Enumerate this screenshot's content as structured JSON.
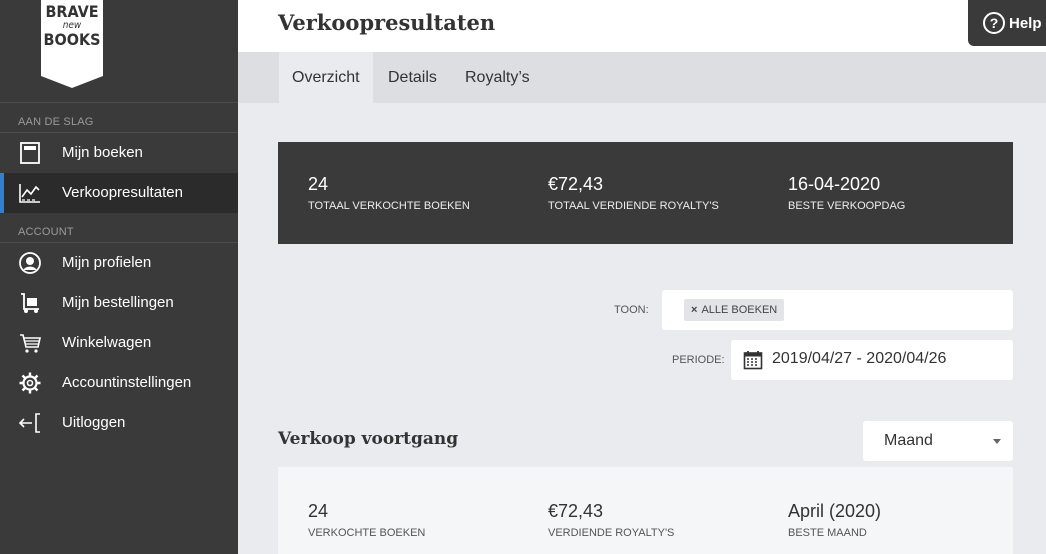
{
  "brand": {
    "line1": "BRAVE",
    "line2": "new",
    "line3": "BOOKS"
  },
  "sidebar": {
    "section1": "AAN DE SLAG",
    "section2": "ACCOUNT",
    "items": [
      {
        "label": "Mijn boeken",
        "icon": "book-icon"
      },
      {
        "label": "Verkoopresultaten",
        "icon": "chart-icon",
        "active": true
      },
      {
        "label": "Mijn profielen",
        "icon": "profile-icon"
      },
      {
        "label": "Mijn bestellingen",
        "icon": "order-icon"
      },
      {
        "label": "Winkelwagen",
        "icon": "cart-icon"
      },
      {
        "label": "Accountinstellingen",
        "icon": "gear-icon"
      },
      {
        "label": "Uitloggen",
        "icon": "logout-icon"
      }
    ]
  },
  "header": {
    "title": "Verkoopresultaten",
    "help_label": "Help",
    "help_symbol": "?"
  },
  "tabs": [
    {
      "label": "Overzicht",
      "active": true
    },
    {
      "label": "Details"
    },
    {
      "label": "Royalty’s"
    }
  ],
  "summary": [
    {
      "value": "24",
      "label": "TOTAAL VERKOCHTE BOEKEN"
    },
    {
      "value": "€72,43",
      "label": "TOTAAL VERDIENDE ROYALTY'S"
    },
    {
      "value": "16-04-2020",
      "label": "BESTE VERKOOPDAG"
    }
  ],
  "filters": {
    "show_label": "TOON:",
    "show_chip": "ALLE BOEKEN",
    "chip_remove": "×",
    "period_label": "PERIODE:",
    "period_value": "2019/04/27 - 2020/04/26"
  },
  "progress": {
    "title": "Verkoop voortgang",
    "interval": "Maand",
    "stats": [
      {
        "value": "24",
        "label": "VERKOCHTE BOEKEN"
      },
      {
        "value": "€72,43",
        "label": "VERDIENDE ROYALTY'S"
      },
      {
        "value": "April (2020)",
        "label": "BESTE MAAND"
      }
    ]
  },
  "colors": {
    "sidebar": "#3a3a3a",
    "active_bar": "#2e80d6",
    "summary_bg": "#3a3a3a",
    "page_bg": "#e9ebee"
  }
}
